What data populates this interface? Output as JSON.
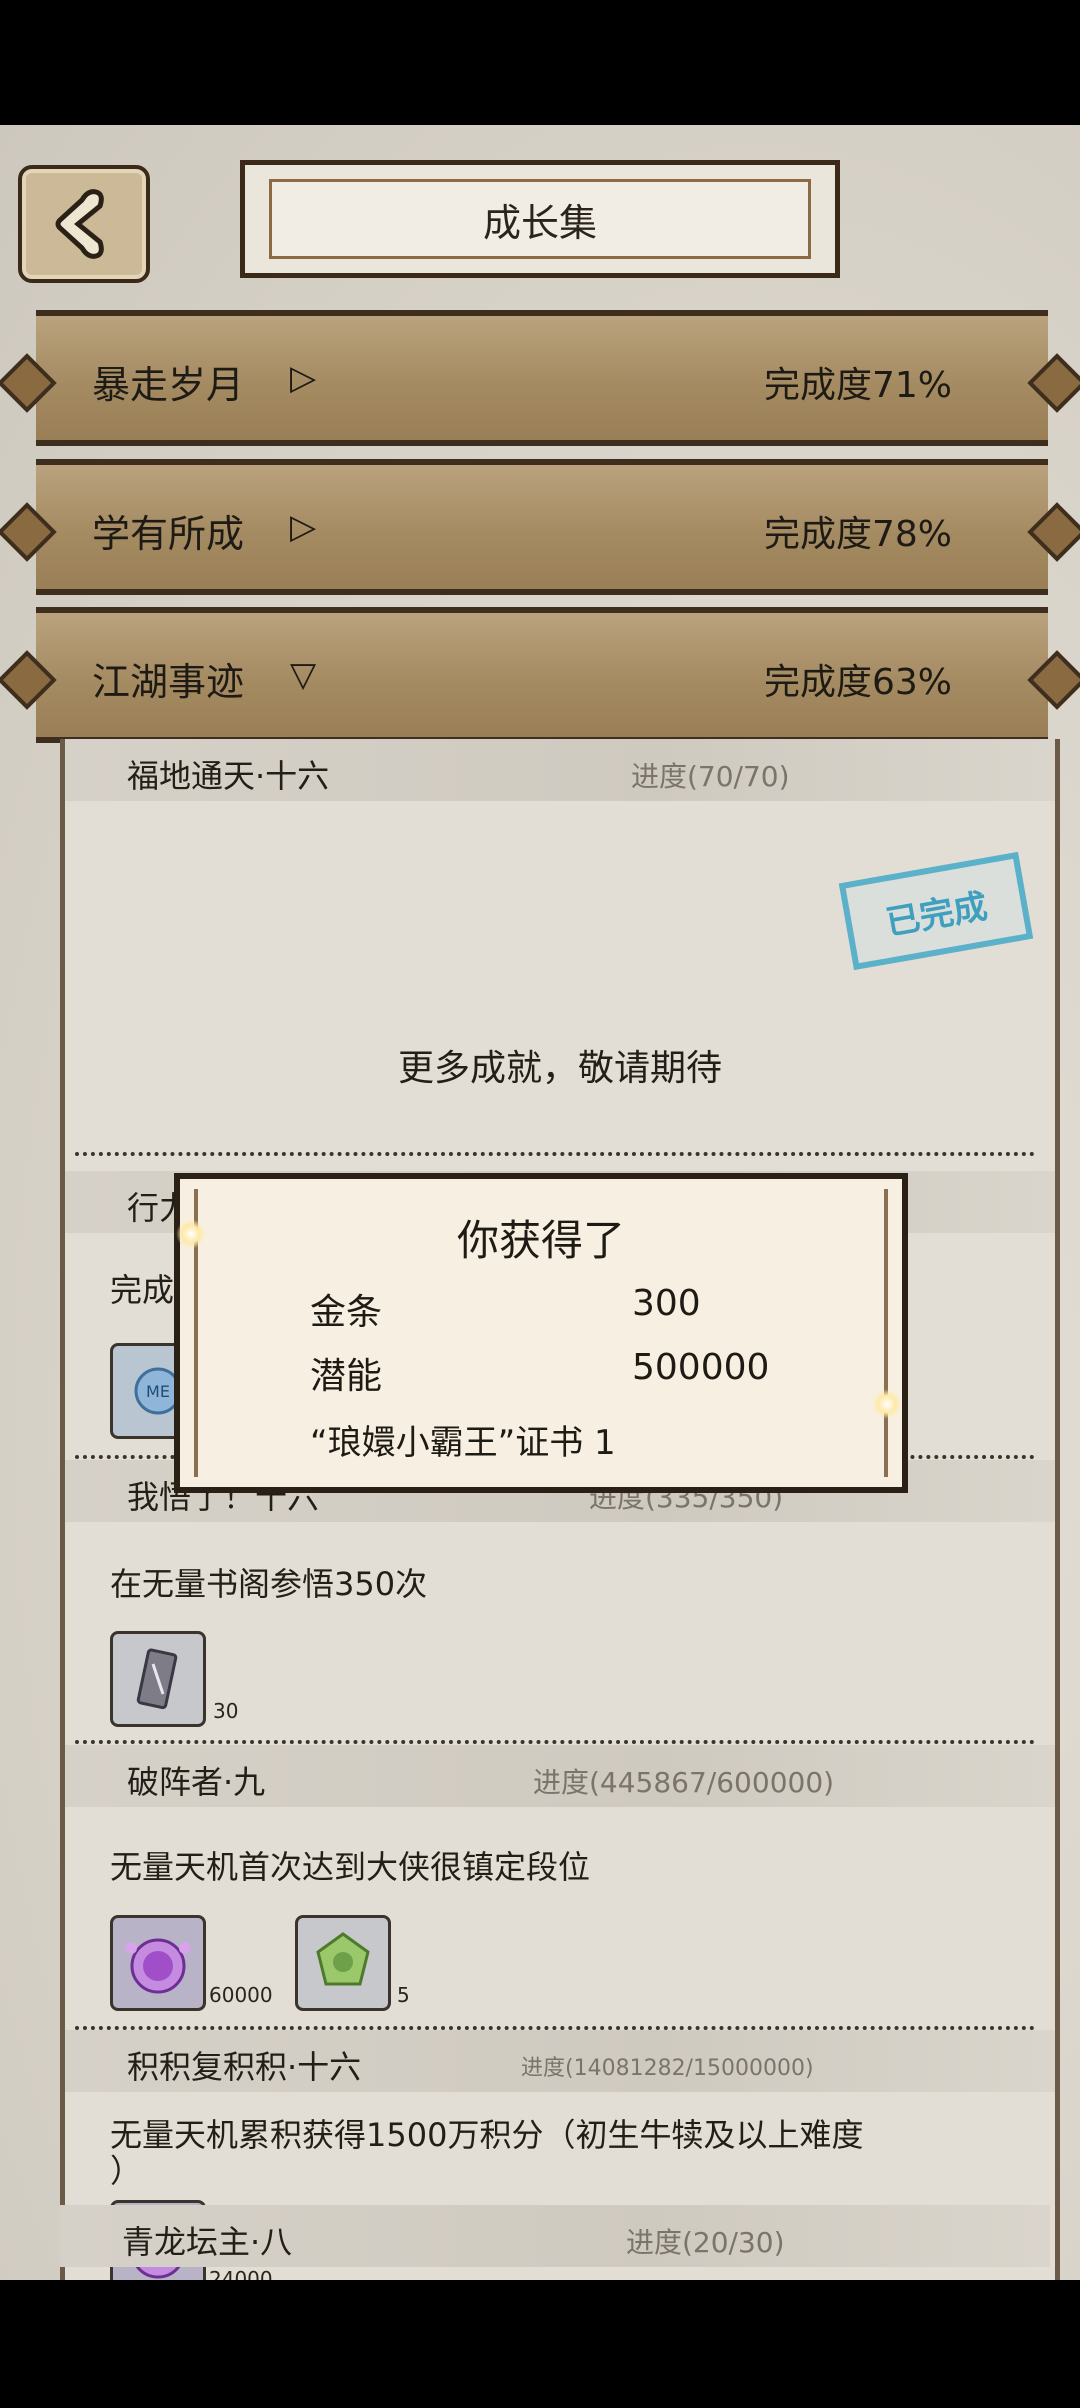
{
  "header": {
    "title": "成长集"
  },
  "categories": [
    {
      "name": "暴走岁月",
      "arrow": "▷",
      "progress": "完成度71%"
    },
    {
      "name": "学有所成",
      "arrow": "▷",
      "progress": "完成度78%"
    },
    {
      "name": "江湖事迹",
      "arrow": "▽",
      "progress": "完成度63%"
    }
  ],
  "achievements": {
    "first": {
      "title": "福地通天·十六",
      "progress": "进度(70/70)",
      "stamp": "已完成"
    },
    "more_text": "更多成就，敬请期待",
    "hidden_row": {
      "title_partial": "行力",
      "desc_partial": "完成"
    },
    "wuwu": {
      "title": "我悟了！十六",
      "progress": "进度(335/350)",
      "desc": "在无量书阁参悟350次",
      "reward_qty": "30"
    },
    "pozhen": {
      "title": "破阵者·九",
      "progress": "进度(445867/600000)",
      "desc": "无量天机首次达到大侠很镇定段位",
      "reward1_qty": "60000",
      "reward2_qty": "5"
    },
    "jiji": {
      "title": "积积复积积·十六",
      "progress": "进度(14081282/15000000)",
      "desc": "无量天机累积获得1500万积分（初生牛犊及以上难度",
      "desc2": "）",
      "reward_qty": "24000"
    },
    "qinglong": {
      "title": "青龙坛主·八",
      "progress": "进度(20/30)"
    }
  },
  "popup": {
    "title": "你获得了",
    "rewards": [
      {
        "name": "金条",
        "value": "300"
      },
      {
        "name": "潜能",
        "value": "500000"
      }
    ],
    "certificate": "“琅嬛小霸王”证书 1"
  },
  "icons": {
    "back": "back-arrow-icon",
    "book": "book-scroll-icon",
    "purple_orb": "purple-orb-icon",
    "green_gem": "green-gem-icon",
    "me_badge": "me-badge-icon"
  },
  "colors": {
    "stamp": "#3e9fbe",
    "bar": "#a58b62",
    "popup_bg": "#f7f0e2"
  }
}
